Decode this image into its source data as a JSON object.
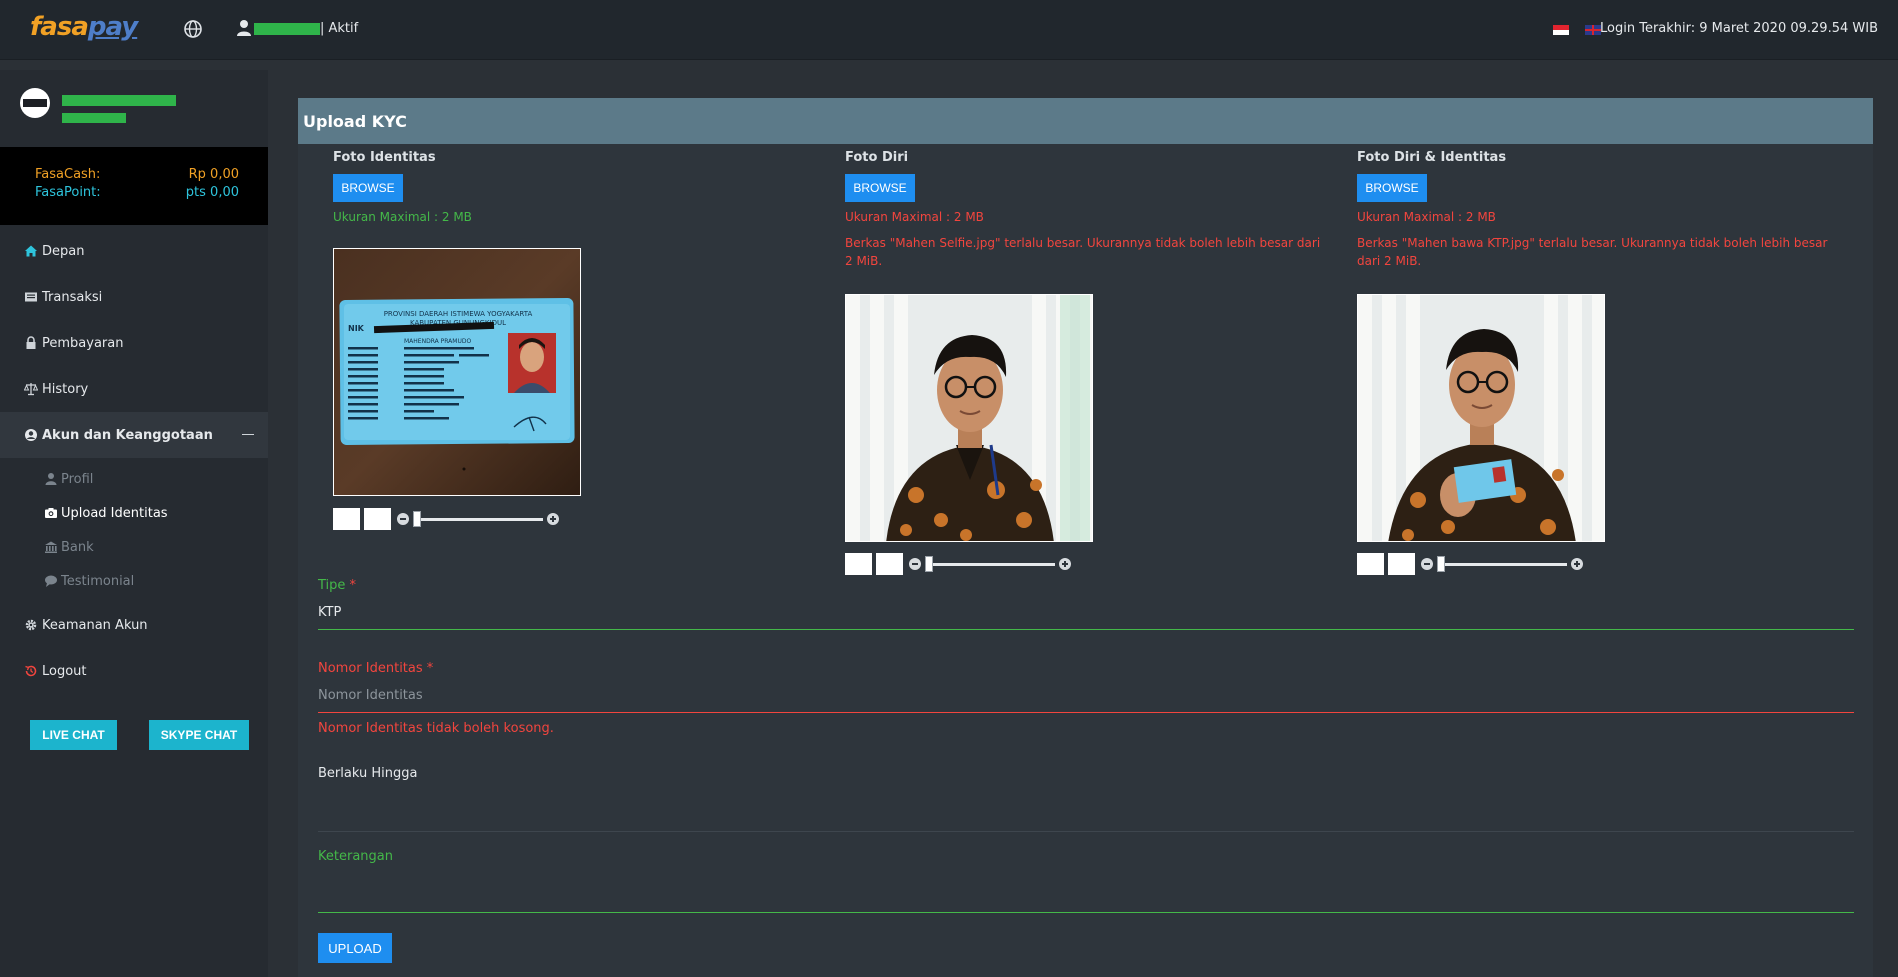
{
  "topbar": {
    "logo_part1": "fasa",
    "logo_part2": "pay",
    "user_status": "| Aktif",
    "last_login": "Login Terakhir: 9 Maret 2020 09.29.54 WIB"
  },
  "sidebar": {
    "wallet": {
      "cash_label": "FasaCash:",
      "cash_value": "Rp 0,00",
      "point_label": "FasaPoint:",
      "point_value": "pts 0,00"
    },
    "menu": [
      {
        "label": "Depan",
        "icon": "home-icon"
      },
      {
        "label": "Transaksi",
        "icon": "newspaper-icon"
      },
      {
        "label": "Pembayaran",
        "icon": "lock-icon"
      },
      {
        "label": "History",
        "icon": "scale-icon"
      },
      {
        "label": "Akun dan Keanggotaan",
        "icon": "user-circle-icon"
      }
    ],
    "submenu": [
      {
        "label": "Profil",
        "icon": "user-icon"
      },
      {
        "label": "Upload Identitas",
        "icon": "camera-icon"
      },
      {
        "label": "Bank",
        "icon": "bank-icon"
      },
      {
        "label": "Testimonial",
        "icon": "comment-icon"
      }
    ],
    "menu_after": [
      {
        "label": "Keamanan Akun",
        "icon": "gear-icon"
      },
      {
        "label": "Logout",
        "icon": "history-icon"
      }
    ],
    "live_chat": "LIVE CHAT",
    "skype_chat": "SKYPE CHAT"
  },
  "panel": {
    "title": "Upload KYC",
    "uploads": [
      {
        "label": "Foto Identitas",
        "browse": "BROWSE",
        "max": "Ukuran Maximal : 2 MB",
        "error": ""
      },
      {
        "label": "Foto Diri",
        "browse": "BROWSE",
        "max": "Ukuran Maximal : 2 MB",
        "error": "Berkas \"Mahen Selfie.jpg\" terlalu besar. Ukurannya tidak boleh lebih besar dari 2 MiB."
      },
      {
        "label": "Foto Diri & Identitas",
        "browse": "BROWSE",
        "max": "Ukuran Maximal : 2 MB",
        "error": "Berkas \"Mahen bawa KTP.jpg\" terlalu besar. Ukurannya tidak boleh lebih besar dari 2 MiB."
      }
    ],
    "id_card": {
      "province": "PROVINSI DAERAH ISTIMEWA YOGYAKARTA",
      "regency": "KABUPATEN GUNUNGKIDUL",
      "nik": "NIK",
      "name": "MAHENDRA PRAMUDO"
    },
    "form": {
      "tipe_label": "Tipe",
      "tipe_value": "KTP",
      "nomor_label": "Nomor Identitas",
      "nomor_placeholder": "Nomor Identitas",
      "nomor_error": "Nomor Identitas tidak boleh kosong.",
      "berlaku_label": "Berlaku Hingga",
      "keterangan_label": "Keterangan",
      "required_mark": "*"
    },
    "upload_button": "UPLOAD"
  },
  "colors": {
    "accent_blue": "#1e8ef0",
    "success_green": "#44b849",
    "error_red": "#f2453e",
    "chat_cyan": "#1cb4cd",
    "panel_header": "#5c7a89"
  }
}
